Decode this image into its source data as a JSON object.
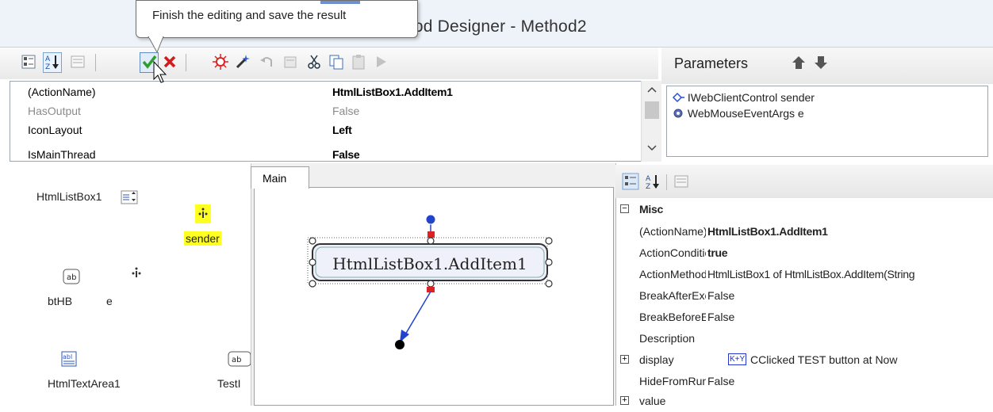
{
  "window": {
    "title": "hod Designer - Method2"
  },
  "tooltip": {
    "text": "Finish the editing and save the result"
  },
  "toolbar": {
    "icons": [
      "categorized-icon",
      "alphabetical-icon",
      "property-pages-icon",
      "ok-check-icon",
      "cancel-x-icon",
      "debug-icon",
      "magic-wand-icon",
      "undo-icon",
      "redo-icon",
      "cut-icon",
      "copy-icon",
      "paste-icon",
      "run-icon"
    ]
  },
  "property_grid": {
    "rows": [
      {
        "name": "(ActionName)",
        "value": "HtmlListBox1.AddItem1"
      },
      {
        "name": "HasOutput",
        "value": "False"
      },
      {
        "name": "IconLayout",
        "value": "Left"
      },
      {
        "name": "IsMainThread",
        "value": "False"
      }
    ]
  },
  "parameters": {
    "title": "Parameters",
    "items": [
      {
        "label": "IWebClientControl sender"
      },
      {
        "label": "WebMouseEventArgs e"
      }
    ]
  },
  "left_panel": {
    "items": [
      {
        "label": "HtmlListBox1"
      },
      {
        "label": "sender"
      },
      {
        "label": "btHB"
      },
      {
        "label": "e"
      },
      {
        "label": "HtmlTextArea1"
      },
      {
        "label": "TestI"
      }
    ]
  },
  "tabs": [
    {
      "label": "Main"
    }
  ],
  "canvas": {
    "node_label": "HtmlListBox1.AddItem1"
  },
  "properties": {
    "category": "Misc",
    "rows": [
      {
        "name": "(ActionName)",
        "value": "HtmlListBox1.AddItem1"
      },
      {
        "name": "ActionCondition",
        "value": "true"
      },
      {
        "name": "ActionMethod",
        "value": "HtmlListBox1 of HtmlListBox.AddItem(String"
      },
      {
        "name": "BreakAfterExecute",
        "value": "False"
      },
      {
        "name": "BreakBeforeExecute",
        "value": "False"
      },
      {
        "name": "Description",
        "value": ""
      },
      {
        "name": "display",
        "value": "CClicked TEST button at Now",
        "badge": "K+Y"
      },
      {
        "name": "HideFromRuntime",
        "value": "False"
      },
      {
        "name": "value",
        "value": ""
      }
    ]
  },
  "colors": {
    "highlight_yellow": "#ffff22",
    "ok_green": "#2e9e2e",
    "cancel_red": "#d31b1b",
    "link_blue": "#1a3fd1"
  }
}
